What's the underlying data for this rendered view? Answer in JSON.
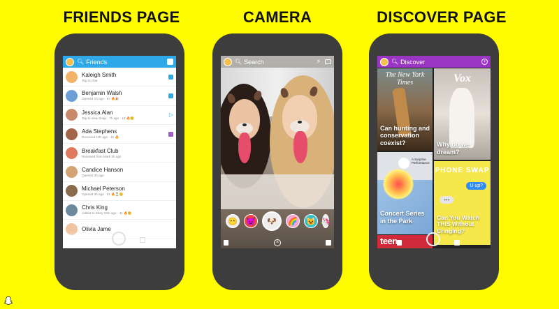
{
  "headings": {
    "friends": "FRIENDS PAGE",
    "camera": "CAMERA",
    "discover": "DISCOVER PAGE"
  },
  "friends": {
    "header_title": "Friends",
    "rows": [
      {
        "name": "Kaleigh Smith",
        "status": "Tap to chat",
        "icon": "chat-icon",
        "color": "#f3b36b"
      },
      {
        "name": "Benjamin Walsh",
        "status": "Opened 1h ago · 67 🔥🎉",
        "icon": "chat-icon",
        "color": "#6b9fd6"
      },
      {
        "name": "Jessica Alan",
        "status": "Tap to view Snap · 7h ago · 13 🔥😊",
        "icon": "snap-icon",
        "color": "#c98a6b"
      },
      {
        "name": "Ada Stephens",
        "status": "Received 10h ago · 41 🔥",
        "icon": "",
        "color": "#a3664b"
      },
      {
        "name": "Breakfast Club",
        "status": "Received from Mark 2h ago",
        "icon": "",
        "color": "#e07a5f"
      },
      {
        "name": "Candice Hanson",
        "status": "Opened 3h ago",
        "icon": "",
        "color": "#d4a373"
      },
      {
        "name": "Michael Peterson",
        "status": "Opened 3h ago · 61 🔥⏳😊",
        "icon": "",
        "color": "#8a6b4b"
      },
      {
        "name": "Chris King",
        "status": "Added to Story 23m ago · 41 🔥😊",
        "icon": "",
        "color": "#6b8a9e"
      },
      {
        "name": "Olivia Jame",
        "status": "",
        "icon": "",
        "color": "#f0c4a0"
      }
    ]
  },
  "camera": {
    "search_label": "Search",
    "lenses": [
      "😶",
      "😈",
      "🐶",
      "🌈",
      "😺",
      "🦄"
    ]
  },
  "discover": {
    "header_title": "Discover",
    "tiles": [
      {
        "brand": "The New York Times",
        "caption": "Can hunting and conservation coexist?"
      },
      {
        "brand": "Vox",
        "caption": "Why do we dream?"
      },
      {
        "brand": "A Surprise Performance",
        "caption": "Concert Series in the Park"
      },
      {
        "brand": "PHONE SWAP",
        "caption": "Can You Watch THIS Without Cringing?",
        "bubble": "U up?"
      },
      {
        "brand": "teen"
      }
    ]
  }
}
